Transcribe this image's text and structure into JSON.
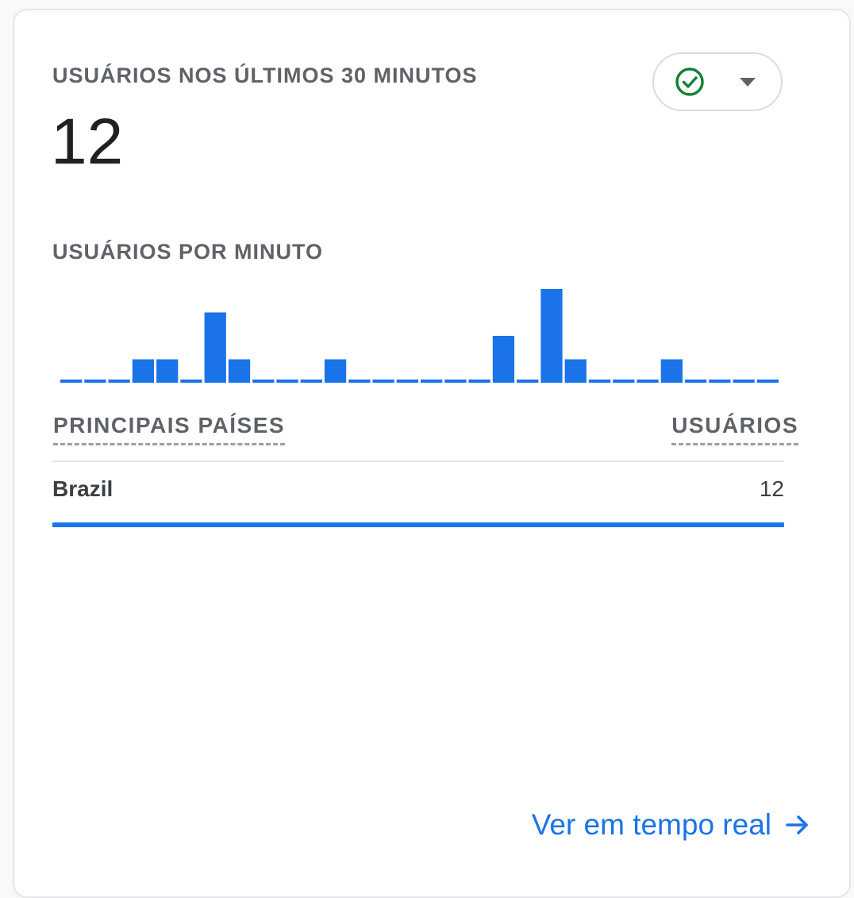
{
  "card": {
    "title": "USUÁRIOS NOS ÚLTIMOS 30 MINUTOS",
    "total_users": "12",
    "status_icon": "check-circle-icon",
    "status_color": "#188038",
    "subtitle": "USUÁRIOS POR MINUTO"
  },
  "chart_data": {
    "type": "bar",
    "bar_color": "#1a73e8",
    "values": [
      0,
      0,
      0,
      1,
      1,
      0,
      3,
      1,
      0,
      0,
      0,
      1,
      0,
      0,
      0,
      0,
      0,
      0,
      2,
      0,
      4,
      1,
      0,
      0,
      0,
      1,
      0,
      0,
      0,
      0
    ]
  },
  "table": {
    "col_country": "PRINCIPAIS PAÍSES",
    "col_users": "USUÁRIOS",
    "rows": [
      {
        "country": "Brazil",
        "users": "12",
        "share": 1.0
      }
    ]
  },
  "footer": {
    "link_label": "Ver em tempo real",
    "arrow_icon": "arrow-right-icon",
    "accent": "#1a73e8"
  }
}
